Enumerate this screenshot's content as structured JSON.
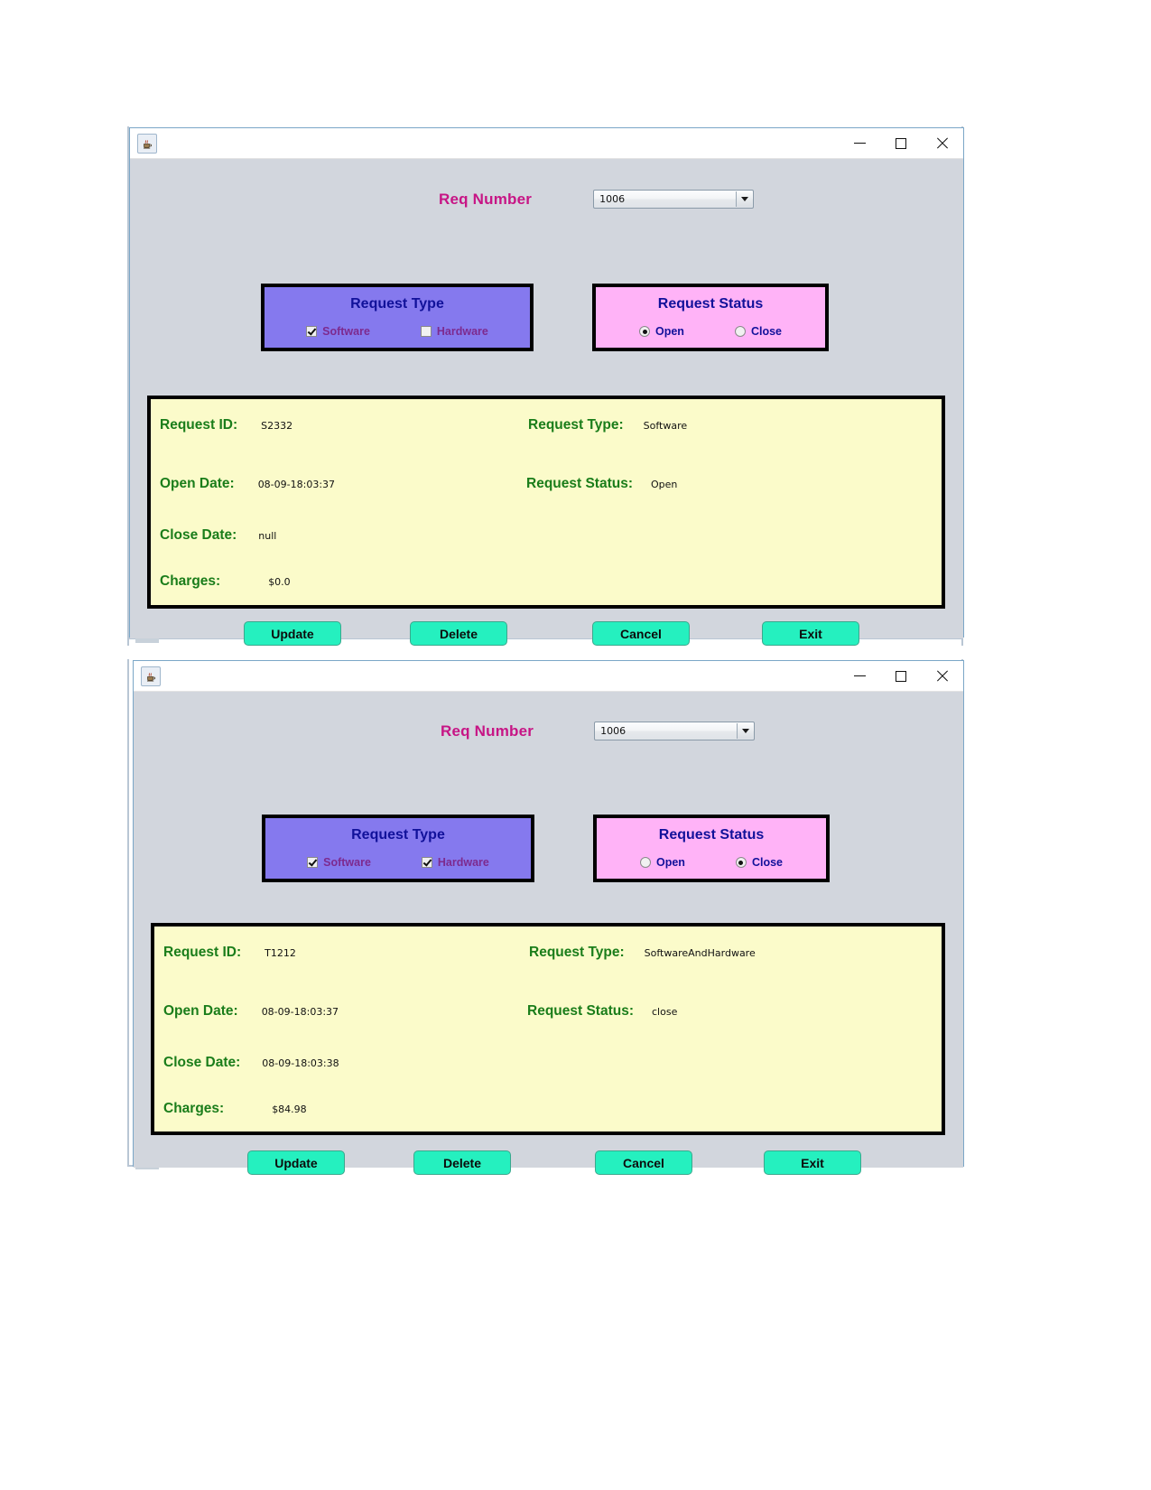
{
  "windows": [
    {
      "id": "window-open-request",
      "titlebar": {
        "app_icon": "java-coffee-cup-icon",
        "minimize_label": "Minimize",
        "maximize_label": "Maximize",
        "close_label": "Close"
      },
      "req_number": {
        "label": "Req Number",
        "value": "1006",
        "dropdown_icon": "chevron-down-icon"
      },
      "request_type_panel": {
        "title": "Request Type",
        "options": [
          {
            "label": "Software",
            "checked": true
          },
          {
            "label": "Hardware",
            "checked": false
          }
        ]
      },
      "request_status_panel": {
        "title": "Request Status",
        "options": [
          {
            "label": "Open",
            "selected": true
          },
          {
            "label": "Close",
            "selected": false
          }
        ]
      },
      "details": [
        {
          "label": "Request ID:",
          "value": "S2332"
        },
        {
          "label": "Request Type:",
          "value": "Software"
        },
        {
          "label": "Open Date:",
          "value": "08-09-18:03:37"
        },
        {
          "label": "Request Status:",
          "value": "Open"
        },
        {
          "label": "Close Date:",
          "value": "null"
        },
        {
          "label": "Charges:",
          "value": "$0.0"
        }
      ],
      "buttons": [
        {
          "label": "Update"
        },
        {
          "label": "Delete"
        },
        {
          "label": "Cancel"
        },
        {
          "label": "Exit"
        }
      ]
    },
    {
      "id": "window-closed-request",
      "titlebar": {
        "app_icon": "java-coffee-cup-icon",
        "minimize_label": "Minimize",
        "maximize_label": "Maximize",
        "close_label": "Close"
      },
      "req_number": {
        "label": "Req Number",
        "value": "1006",
        "dropdown_icon": "chevron-down-icon"
      },
      "request_type_panel": {
        "title": "Request Type",
        "options": [
          {
            "label": "Software",
            "checked": true
          },
          {
            "label": "Hardware",
            "checked": true
          }
        ]
      },
      "request_status_panel": {
        "title": "Request Status",
        "options": [
          {
            "label": "Open",
            "selected": false
          },
          {
            "label": "Close",
            "selected": true
          }
        ]
      },
      "details": [
        {
          "label": "Request ID:",
          "value": "T1212"
        },
        {
          "label": "Request Type:",
          "value": "SoftwareAndHardware"
        },
        {
          "label": "Open Date:",
          "value": "08-09-18:03:37"
        },
        {
          "label": "Request Status:",
          "value": "close"
        },
        {
          "label": "Close Date:",
          "value": "08-09-18:03:38"
        },
        {
          "label": "Charges:",
          "value": "$84.98"
        }
      ],
      "buttons": [
        {
          "label": "Update"
        },
        {
          "label": "Delete"
        },
        {
          "label": "Cancel"
        },
        {
          "label": "Exit"
        }
      ]
    }
  ],
  "colors": {
    "window_background": "#d2d6dd",
    "request_type_panel": "#8579ee",
    "request_status_panel": "#ffb3f7",
    "details_panel": "#fbfbca",
    "button": "#25f0bf",
    "label_magenta": "#c71585",
    "label_green": "#1a7d1a",
    "panel_title_blue": "#11119a"
  }
}
